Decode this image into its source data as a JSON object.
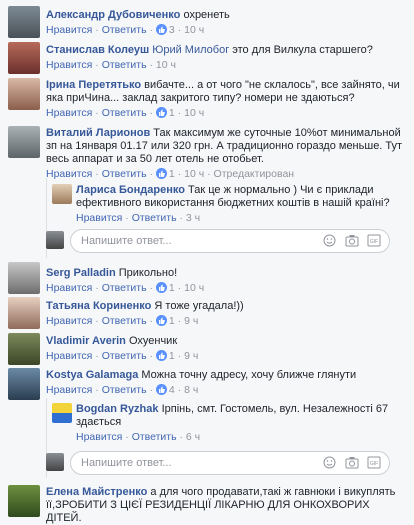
{
  "comments": [
    {
      "name": "Александр Дубовиченко",
      "text": " охренеть",
      "like": "Нравится",
      "reply": "Ответить",
      "likes": "3",
      "time": "10 ч"
    },
    {
      "name": "Станислав Колеуш",
      "mention": "Юрий Милобог",
      "text": " это для Вилкула старшего?",
      "like": "Нравится",
      "reply": "Ответить",
      "time": "10 ч"
    },
    {
      "name": "Ірина Перетятько",
      "text": " вибачте... а от чого \"не склалось\", все зайнято, чи яка приЧина... заклад закритого типу? номери не здаються?",
      "like": "Нравится",
      "reply": "Ответить",
      "likes": "1",
      "time": "10 ч"
    },
    {
      "name": "Виталий Ларионов",
      "text": " Так максимум же суточные 10%от минимальной зп на 1января 01.17 или 320 грн. А традиционно гораздо меньше. Тут весь аппарат и за 50 лет отель не отобьет.",
      "like": "Нравится",
      "reply": "Ответить",
      "likes": "1",
      "time": "10 ч",
      "edited": "Отредактирован"
    },
    {
      "name": "Лариса Бондаренко",
      "text": " Так це ж нормально ) Чи є приклади ефективного використання бюджетних коштів в нашій країні?",
      "like": "Нравится",
      "reply": "Ответить",
      "time": "3 ч"
    },
    {
      "name": "Serg Palladin",
      "text": " Прикольно!",
      "like": "Нравится",
      "reply": "Ответить",
      "likes": "1",
      "time": "10 ч"
    },
    {
      "name": "Татьяна Кориненко",
      "text": " Я тоже угадала!))",
      "like": "Нравится",
      "reply": "Ответить",
      "likes": "1",
      "time": "9 ч"
    },
    {
      "name": "Vladimir Averin",
      "text": " Охуенчик",
      "like": "Нравится",
      "reply": "Ответить",
      "likes": "1",
      "time": "9 ч"
    },
    {
      "name": "Kostya Galamaga",
      "text": " Можна точну адресу, хочу ближче глянути",
      "like": "Нравится",
      "reply": "Ответить",
      "likes": "4",
      "time": "8 ч"
    },
    {
      "name": "Bogdan Ryzhak",
      "text": " Ірпінь, смт. Гостомель, вул. Незалежності 67 здається",
      "like": "Нравится",
      "reply": "Ответить",
      "time": "6 ч"
    },
    {
      "name": "Елена Майстренко",
      "text": " а для чого продавати,такі ж гавнюки і викуплять її,ЗРОБИТИ З ЦІЄЇ РЕЗИДЕНЦІЇ ЛІКАРНЮ ДЛЯ ОНКОХВОРИХ ДІТЕЙ."
    }
  ],
  "reply_placeholder": "Напишите ответ...",
  "colors": {
    "link": "#365899",
    "meta": "#90949c",
    "like": "#5890ff"
  }
}
